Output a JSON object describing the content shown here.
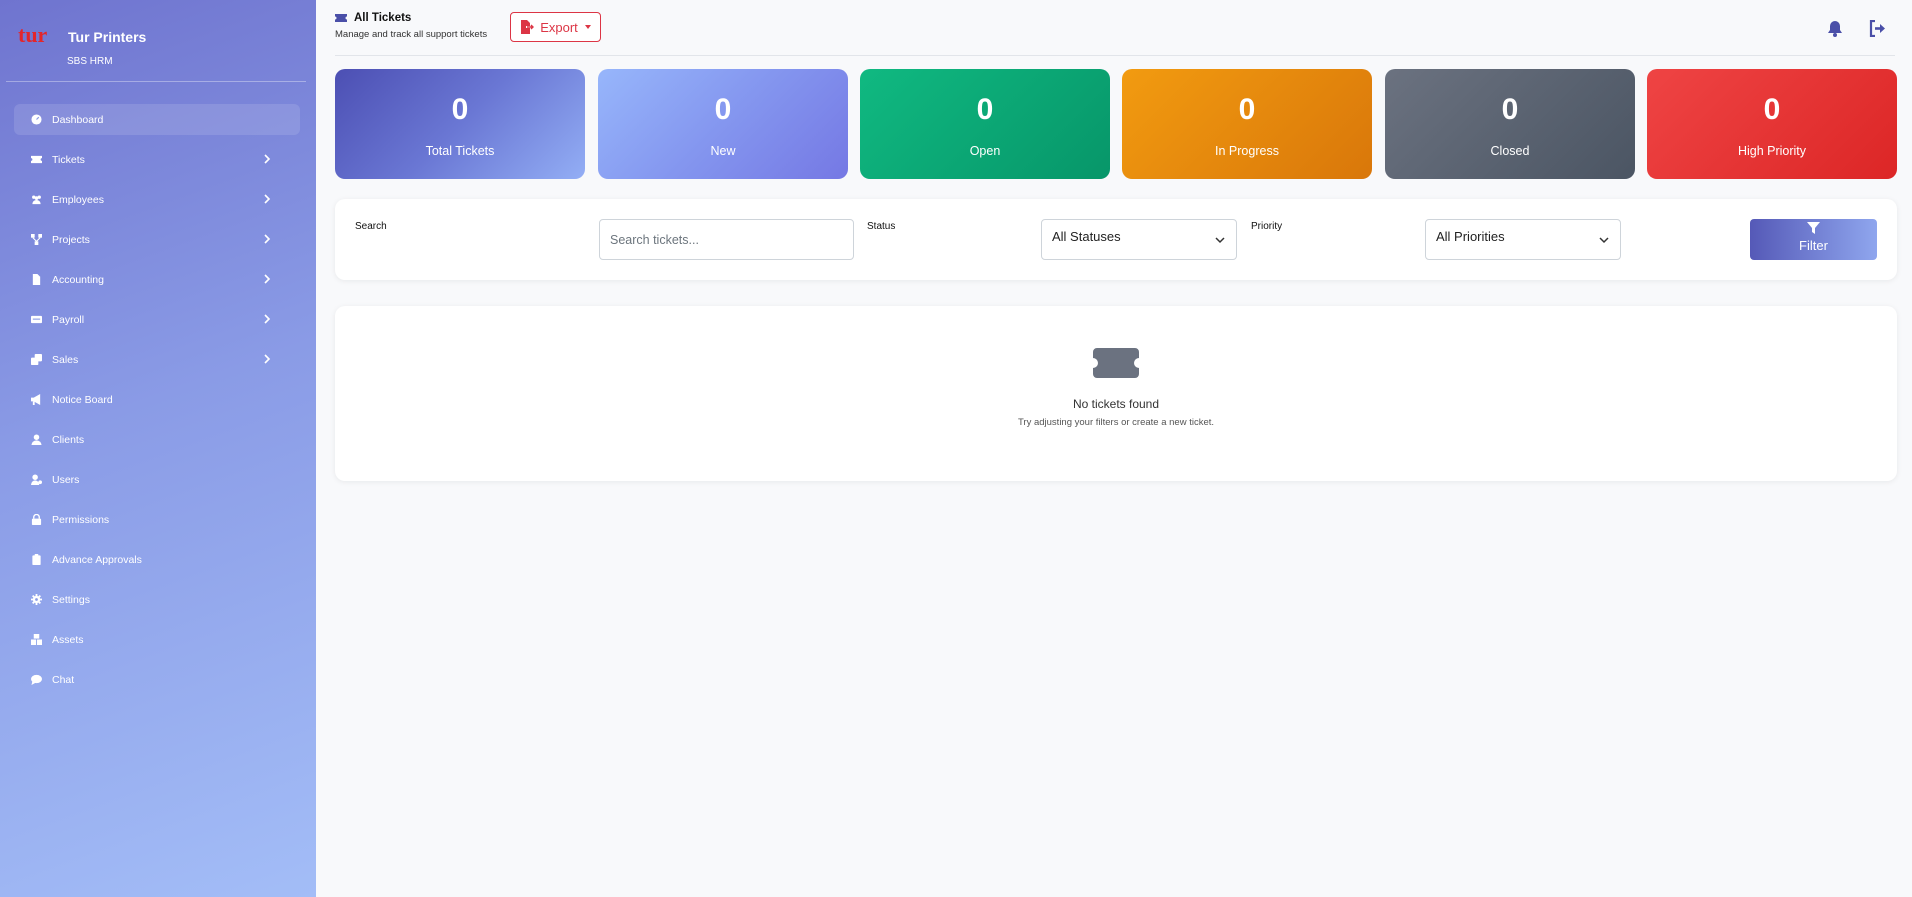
{
  "brand": {
    "name": "Tur Printers",
    "subtitle": "SBS HRM",
    "logo_text": "tur"
  },
  "sidebar": {
    "items": [
      {
        "label": "Dashboard",
        "icon": "dashboard-icon",
        "has_submenu": false,
        "active": true
      },
      {
        "label": "Tickets",
        "icon": "ticket-icon",
        "has_submenu": true
      },
      {
        "label": "Employees",
        "icon": "users-icon",
        "has_submenu": true
      },
      {
        "label": "Projects",
        "icon": "project-icon",
        "has_submenu": true
      },
      {
        "label": "Accounting",
        "icon": "document-icon",
        "has_submenu": true
      },
      {
        "label": "Payroll",
        "icon": "money-icon",
        "has_submenu": true
      },
      {
        "label": "Sales",
        "icon": "copy-icon",
        "has_submenu": true
      },
      {
        "label": "Notice Board",
        "icon": "megaphone-icon",
        "has_submenu": false
      },
      {
        "label": "Clients",
        "icon": "user-icon",
        "has_submenu": false
      },
      {
        "label": "Users",
        "icon": "user-gear-icon",
        "has_submenu": false
      },
      {
        "label": "Permissions",
        "icon": "lock-icon",
        "has_submenu": false
      },
      {
        "label": "Advance Approvals",
        "icon": "clipboard-icon",
        "has_submenu": false
      },
      {
        "label": "Settings",
        "icon": "gear-icon",
        "has_submenu": false
      },
      {
        "label": "Assets",
        "icon": "boxes-icon",
        "has_submenu": false
      },
      {
        "label": "Chat",
        "icon": "chat-icon",
        "has_submenu": false
      }
    ]
  },
  "header": {
    "title": "All Tickets",
    "subtitle": "Manage and track all support tickets",
    "export_label": "Export"
  },
  "stats": [
    {
      "value": "0",
      "label": "Total Tickets"
    },
    {
      "value": "0",
      "label": "New"
    },
    {
      "value": "0",
      "label": "Open"
    },
    {
      "value": "0",
      "label": "In Progress"
    },
    {
      "value": "0",
      "label": "Closed"
    },
    {
      "value": "0",
      "label": "High Priority"
    }
  ],
  "filters": {
    "search_label": "Search",
    "search_placeholder": "Search tickets...",
    "status_label": "Status",
    "status_value": "All Statuses",
    "priority_label": "Priority",
    "priority_value": "All Priorities",
    "filter_button": "Filter"
  },
  "empty_state": {
    "title": "No tickets found",
    "subtitle": "Try adjusting your filters or create a new ticket."
  },
  "colors": {
    "accent": "#5a5fc0",
    "danger": "#dc3545",
    "card_total": "#5053b8",
    "card_new": "#8d9ff0",
    "card_open": "#0fae7b",
    "card_progress": "#ea8a0c",
    "card_closed": "#5b616e",
    "card_high": "#e23535"
  }
}
